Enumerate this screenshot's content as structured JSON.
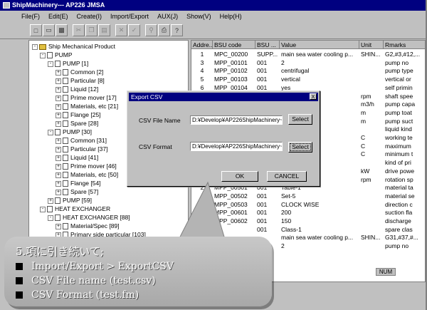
{
  "window": {
    "title": "ShipMachinery--- AP226   JMSA"
  },
  "menu": [
    "File(F)",
    "Edit(E)",
    "Create(I)",
    "Import/Export",
    "AUX(J)",
    "Show(V)",
    "Help(H)"
  ],
  "toolbar": {
    "icons": [
      "new-file-icon",
      "open-folder-icon",
      "save-icon",
      "cut-icon",
      "copy-icon",
      "paste-icon",
      "delete-icon",
      "check-icon",
      "search-icon",
      "print-icon",
      "help-icon"
    ]
  },
  "tree": {
    "nodes": [
      {
        "label": "Ship Mechanical Product",
        "level": 0,
        "exp": "-",
        "icon": "folder"
      },
      {
        "label": "PUMP",
        "level": 1,
        "exp": "-",
        "icon": "doc"
      },
      {
        "label": "PUMP [1]",
        "level": 2,
        "exp": "-",
        "icon": "doc"
      },
      {
        "label": "Common [2]",
        "level": 3,
        "exp": "+",
        "icon": "doc"
      },
      {
        "label": "Particular [8]",
        "level": 3,
        "exp": "+",
        "icon": "doc"
      },
      {
        "label": "Liquid [12]",
        "level": 3,
        "exp": "+",
        "icon": "doc"
      },
      {
        "label": "Prime mover [17]",
        "level": 3,
        "exp": "+",
        "icon": "doc"
      },
      {
        "label": "Materials, etc [21]",
        "level": 3,
        "exp": "+",
        "icon": "doc"
      },
      {
        "label": "Flange [25]",
        "level": 3,
        "exp": "+",
        "icon": "doc"
      },
      {
        "label": "Spare [28]",
        "level": 3,
        "exp": "+",
        "icon": "doc"
      },
      {
        "label": "PUMP [30]",
        "level": 2,
        "exp": "-",
        "icon": "doc"
      },
      {
        "label": "Common [31]",
        "level": 3,
        "exp": "+",
        "icon": "doc"
      },
      {
        "label": "Particular [37]",
        "level": 3,
        "exp": "+",
        "icon": "doc"
      },
      {
        "label": "Liquid [41]",
        "level": 3,
        "exp": "+",
        "icon": "doc"
      },
      {
        "label": "Prime mover [46]",
        "level": 3,
        "exp": "+",
        "icon": "doc"
      },
      {
        "label": "Materials, etc [50]",
        "level": 3,
        "exp": "+",
        "icon": "doc"
      },
      {
        "label": "Flange [54]",
        "level": 3,
        "exp": "+",
        "icon": "doc"
      },
      {
        "label": "Spare [57]",
        "level": 3,
        "exp": "+",
        "icon": "doc"
      },
      {
        "label": "PUMP [59]",
        "level": 2,
        "exp": "+",
        "icon": "doc"
      },
      {
        "label": "HEAT EXCHANGER",
        "level": 1,
        "exp": "-",
        "icon": "doc"
      },
      {
        "label": "HEAT EXCHANGER [88]",
        "level": 2,
        "exp": "-",
        "icon": "doc"
      },
      {
        "label": "Material/Spec [89]",
        "level": 3,
        "exp": "+",
        "icon": "doc"
      },
      {
        "label": "Primary side particular [103]",
        "level": 3,
        "exp": "+",
        "icon": "doc"
      }
    ]
  },
  "grid": {
    "columns": [
      "Addre...",
      "BSU code",
      "BSU ...",
      "Value",
      "Unit",
      "Rmarks"
    ],
    "rows": [
      [
        "1",
        "MPC_00200",
        "SUPP...",
        "main sea water cooling p...",
        "SHIN...",
        "G2,#3,#12,..."
      ],
      [
        "3",
        "MPP_00101",
        "001",
        "2",
        "",
        "pump no"
      ],
      [
        "4",
        "MPP_00102",
        "001",
        "centrifugal",
        "",
        "pump type"
      ],
      [
        "5",
        "MPP_00103",
        "001",
        "vertical",
        "",
        "vertical or"
      ],
      [
        "6",
        "MPP_00104",
        "001",
        "yes",
        "",
        "self primin"
      ],
      [
        "",
        "",
        "",
        "",
        "rpm",
        "shaft spee"
      ],
      [
        "",
        "",
        "",
        "",
        "m3/h",
        "pump capa"
      ],
      [
        "",
        "",
        "",
        "",
        "m",
        "pump toat"
      ],
      [
        "",
        "",
        "",
        "",
        "m",
        "pump suct"
      ],
      [
        "",
        "",
        "",
        "",
        "",
        "liquid kind"
      ],
      [
        "",
        "",
        "",
        "",
        "C",
        "working te"
      ],
      [
        "",
        "",
        "",
        "",
        "C",
        "maximum"
      ],
      [
        "",
        "",
        "",
        "",
        "C",
        "minimum t"
      ],
      [
        "",
        "",
        "",
        "TOR",
        "",
        "kind of pri"
      ],
      [
        "",
        "",
        "",
        "",
        "kW",
        "drive powe"
      ],
      [
        "",
        "",
        "",
        "",
        "rpm",
        "rotation sp"
      ],
      [
        "2",
        "MPP_00501",
        "001",
        "Table-1",
        "",
        "material ta"
      ],
      [
        "",
        "MPP_00502",
        "001",
        "Set-5",
        "",
        "material se"
      ],
      [
        "",
        "MPP_00503",
        "001",
        "CLOCK WISE",
        "",
        "direction c"
      ],
      [
        "",
        "MPP_00601",
        "001",
        "200",
        "",
        "suction fla"
      ],
      [
        "",
        "MPP_00602",
        "001",
        "150",
        "",
        "discharge"
      ],
      [
        "",
        "",
        "001",
        "Class-1",
        "",
        "spare clas"
      ],
      [
        "",
        "",
        "",
        "main sea water cooling p...",
        "SHIN...",
        "G31,#37,#..."
      ],
      [
        "",
        "",
        "",
        "2",
        "",
        "pump no"
      ]
    ]
  },
  "dialog": {
    "title": "Export CSV",
    "close": "X",
    "file_label": "CSV File Name",
    "file_value": "D:¥Develop¥AP226ShipMachinery~",
    "format_label": "CSV Format",
    "format_value": "D:¥Develop¥AP226ShipMachinery~",
    "select1": "Select",
    "select2": "Select",
    "ok": "OK",
    "cancel": "CANCEL"
  },
  "status": {
    "num": "NUM"
  },
  "callout": {
    "title": "5.項に引き続いて;",
    "items": [
      "Import/Export > ExportCSV",
      "CSV File name  (test.csv)",
      "CSV Format  (test.fm)"
    ]
  },
  "colors": {
    "titlebar": "#000080",
    "chrome": "#c0c0c0",
    "callout": "#b8b8b8"
  }
}
